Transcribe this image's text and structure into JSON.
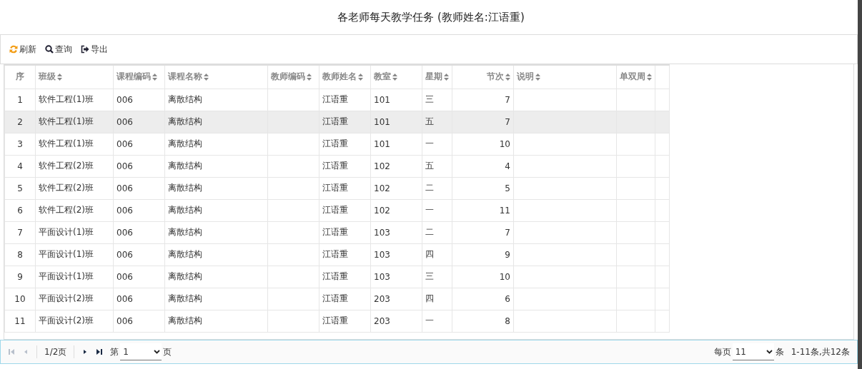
{
  "title": "各老师每天教学任务 (教师姓名:江语重)",
  "toolbar": [
    {
      "kind": "refresh",
      "label": "刷新"
    },
    {
      "kind": "search",
      "label": "查询"
    },
    {
      "kind": "export",
      "label": "导出"
    }
  ],
  "table": {
    "columns": [
      {
        "label": "序",
        "sortable": false
      },
      {
        "label": "班级",
        "sortable": true
      },
      {
        "label": "课程编码",
        "sortable": true
      },
      {
        "label": "课程名称",
        "sortable": true
      },
      {
        "label": "教师编码",
        "sortable": true
      },
      {
        "label": "教师姓名",
        "sortable": true
      },
      {
        "label": "教室",
        "sortable": true
      },
      {
        "label": "星期",
        "sortable": true
      },
      {
        "label": "节次",
        "sortable": true
      },
      {
        "label": "说明",
        "sortable": true
      },
      {
        "label": "单双周",
        "sortable": true
      }
    ],
    "rows": [
      {
        "selected": false,
        "cells": [
          "1",
          "软件工程(1)班",
          "006",
          "离散结构",
          "",
          "江语重",
          "101",
          "三",
          "7",
          "",
          ""
        ]
      },
      {
        "selected": true,
        "cells": [
          "2",
          "软件工程(1)班",
          "006",
          "离散结构",
          "",
          "江语重",
          "101",
          "五",
          "7",
          "",
          ""
        ]
      },
      {
        "selected": false,
        "cells": [
          "3",
          "软件工程(1)班",
          "006",
          "离散结构",
          "",
          "江语重",
          "101",
          "一",
          "10",
          "",
          ""
        ]
      },
      {
        "selected": false,
        "cells": [
          "4",
          "软件工程(2)班",
          "006",
          "离散结构",
          "",
          "江语重",
          "102",
          "五",
          "4",
          "",
          ""
        ]
      },
      {
        "selected": false,
        "cells": [
          "5",
          "软件工程(2)班",
          "006",
          "离散结构",
          "",
          "江语重",
          "102",
          "二",
          "5",
          "",
          ""
        ]
      },
      {
        "selected": false,
        "cells": [
          "6",
          "软件工程(2)班",
          "006",
          "离散结构",
          "",
          "江语重",
          "102",
          "一",
          "11",
          "",
          ""
        ]
      },
      {
        "selected": false,
        "cells": [
          "7",
          "平面设计(1)班",
          "006",
          "离散结构",
          "",
          "江语重",
          "103",
          "二",
          "7",
          "",
          ""
        ]
      },
      {
        "selected": false,
        "cells": [
          "8",
          "平面设计(1)班",
          "006",
          "离散结构",
          "",
          "江语重",
          "103",
          "四",
          "9",
          "",
          ""
        ]
      },
      {
        "selected": false,
        "cells": [
          "9",
          "平面设计(1)班",
          "006",
          "离散结构",
          "",
          "江语重",
          "103",
          "三",
          "10",
          "",
          ""
        ]
      },
      {
        "selected": false,
        "cells": [
          "10",
          "平面设计(2)班",
          "006",
          "离散结构",
          "",
          "江语重",
          "203",
          "四",
          "6",
          "",
          ""
        ]
      },
      {
        "selected": false,
        "cells": [
          "11",
          "平面设计(2)班",
          "006",
          "离散结构",
          "",
          "江语重",
          "203",
          "一",
          "8",
          "",
          ""
        ]
      }
    ]
  },
  "pager": {
    "page_info": "1/2页",
    "page_prefix": "第",
    "page_value": "1",
    "page_suffix": "页",
    "per_page_prefix": "每页",
    "per_page_value": "11",
    "per_page_suffix": "条",
    "summary": "1-11条,共12条"
  }
}
